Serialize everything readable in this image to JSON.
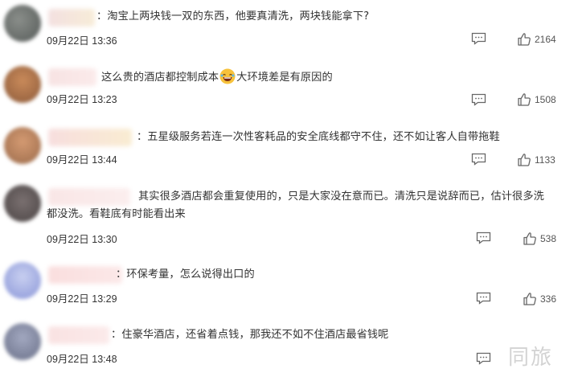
{
  "comments": [
    {
      "text_lines": [
        "：淘宝上两块钱一双的东西，他要真清洗，两块钱能拿下?"
      ],
      "time": "09月22日 13:36",
      "likes": "2164"
    },
    {
      "text_before_emoji": "这么贵的酒店都控制成本",
      "emoji": "laughing-emoji",
      "text_after_emoji": "大环境差是有原因的",
      "time": "09月22日 13:23",
      "likes": "1508"
    },
    {
      "text_lines": [
        "：五星级服务若连一次性客耗品的安全底线都守不住，还不如让客人自带拖鞋"
      ],
      "time": "09月22日 13:44",
      "likes": "1133"
    },
    {
      "text_lines": [
        "其实很多酒店都会重复使用的，只是大家没在意而已。清洗只是说辞而已，估计很多洗",
        "都没洗。看鞋底有时能看出来"
      ],
      "time": "09月22日 13:30",
      "likes": "538"
    },
    {
      "text_lines": [
        "：环保考量，怎么说得出口的"
      ],
      "time": "09月22日 13:29",
      "likes": "336"
    },
    {
      "text_lines": [
        "：住豪华酒店，还省着点钱，那我还不如不住酒店最省钱呢"
      ],
      "time": "09月22日 13:48",
      "likes": ""
    }
  ],
  "watermark": "同旅",
  "colors": {
    "text": "#333333",
    "icon": "#666666",
    "background": "#ffffff"
  }
}
